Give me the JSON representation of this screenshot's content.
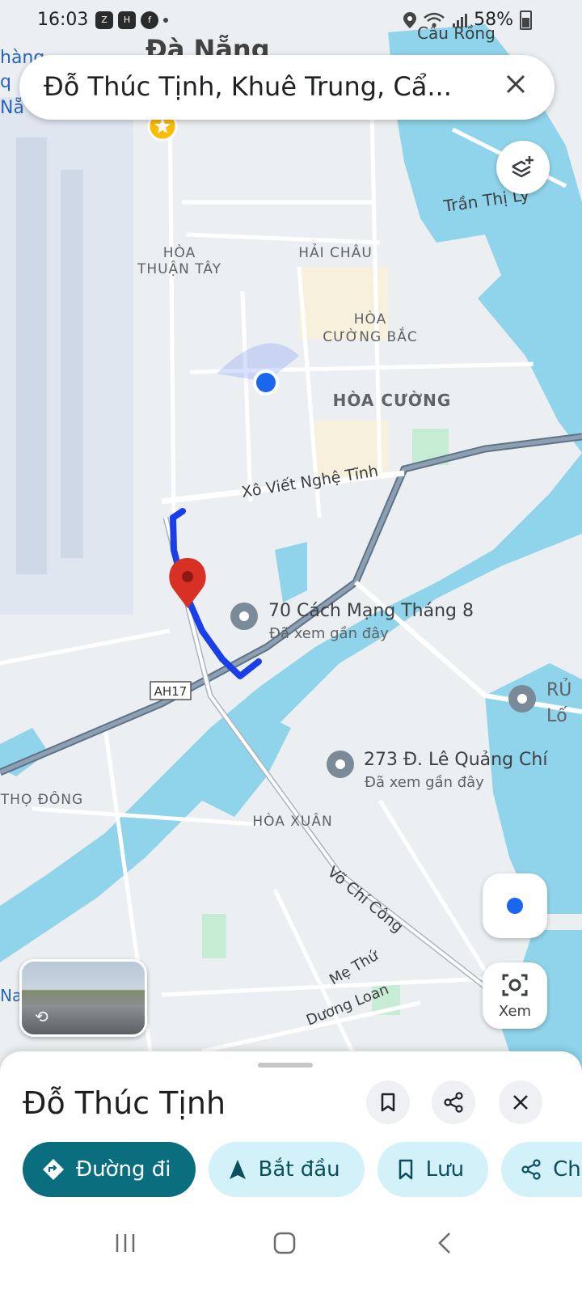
{
  "status_bar": {
    "time": "16:03",
    "app_icons": [
      "zalo-icon",
      "h-icon",
      "facebook-icon",
      "dot-icon"
    ],
    "battery": "58%"
  },
  "search": {
    "query": "Đỗ Thúc Tịnh, Khuê Trung, Cẩ..."
  },
  "map": {
    "city_label": "Đà Nẵng",
    "labels": {
      "cau_rong": "Cầu Rồng",
      "tran_thi_ly": "Trần Thị Lý",
      "hoa_thuan_tay": [
        "HÒA",
        "THUẬN TÂY"
      ],
      "hai_chau": "HẢI CHÂU",
      "hoa_cuong_bac": [
        "HÒA",
        "CƯỜNG BẮC"
      ],
      "hoa_cuong": "HÒA CƯỜNG",
      "xo_viet_nghe_tinh": "Xô Viết Nghệ Tĩnh",
      "ah17": "AH17",
      "tho_dong": "THỌ ĐÔNG",
      "hoa_xuan": "HÒA XUÂN",
      "vo_chi_cong": "Võ Chí Công",
      "me_thu": "Mẹ Thứ",
      "duong_loan": "Dương Loan",
      "edge_left": [
        "hàng",
        "q",
        "Nẵ"
      ],
      "edge_left_bottom": "Na",
      "edge_right": [
        "RỦ",
        "Lố"
      ]
    },
    "places": [
      {
        "name": "70 Cách Mạng Tháng 8",
        "note": "Đã xem gần đây"
      },
      {
        "name": "273 Đ. Lê Quảng Chí",
        "note": "Đã xem gần đây"
      }
    ],
    "colors": {
      "water": "#8fd4ea",
      "route": "#1a3ee8",
      "pin": "#d93025",
      "land": "#eceff1",
      "road": "#ffffff",
      "major_road": "#5f7387"
    }
  },
  "controls": {
    "layers_icon": "layers-icon",
    "location_icon": "my-location-icon",
    "lens_label": "Xem"
  },
  "place_sheet": {
    "title": "Đỗ Thúc Tịnh",
    "chips": {
      "directions": "Đường đi",
      "start": "Bắt đầu",
      "save": "Lưu",
      "share": "Ch"
    }
  },
  "nav_bar": {
    "icons": [
      "recents-icon",
      "home-icon",
      "back-icon"
    ]
  }
}
